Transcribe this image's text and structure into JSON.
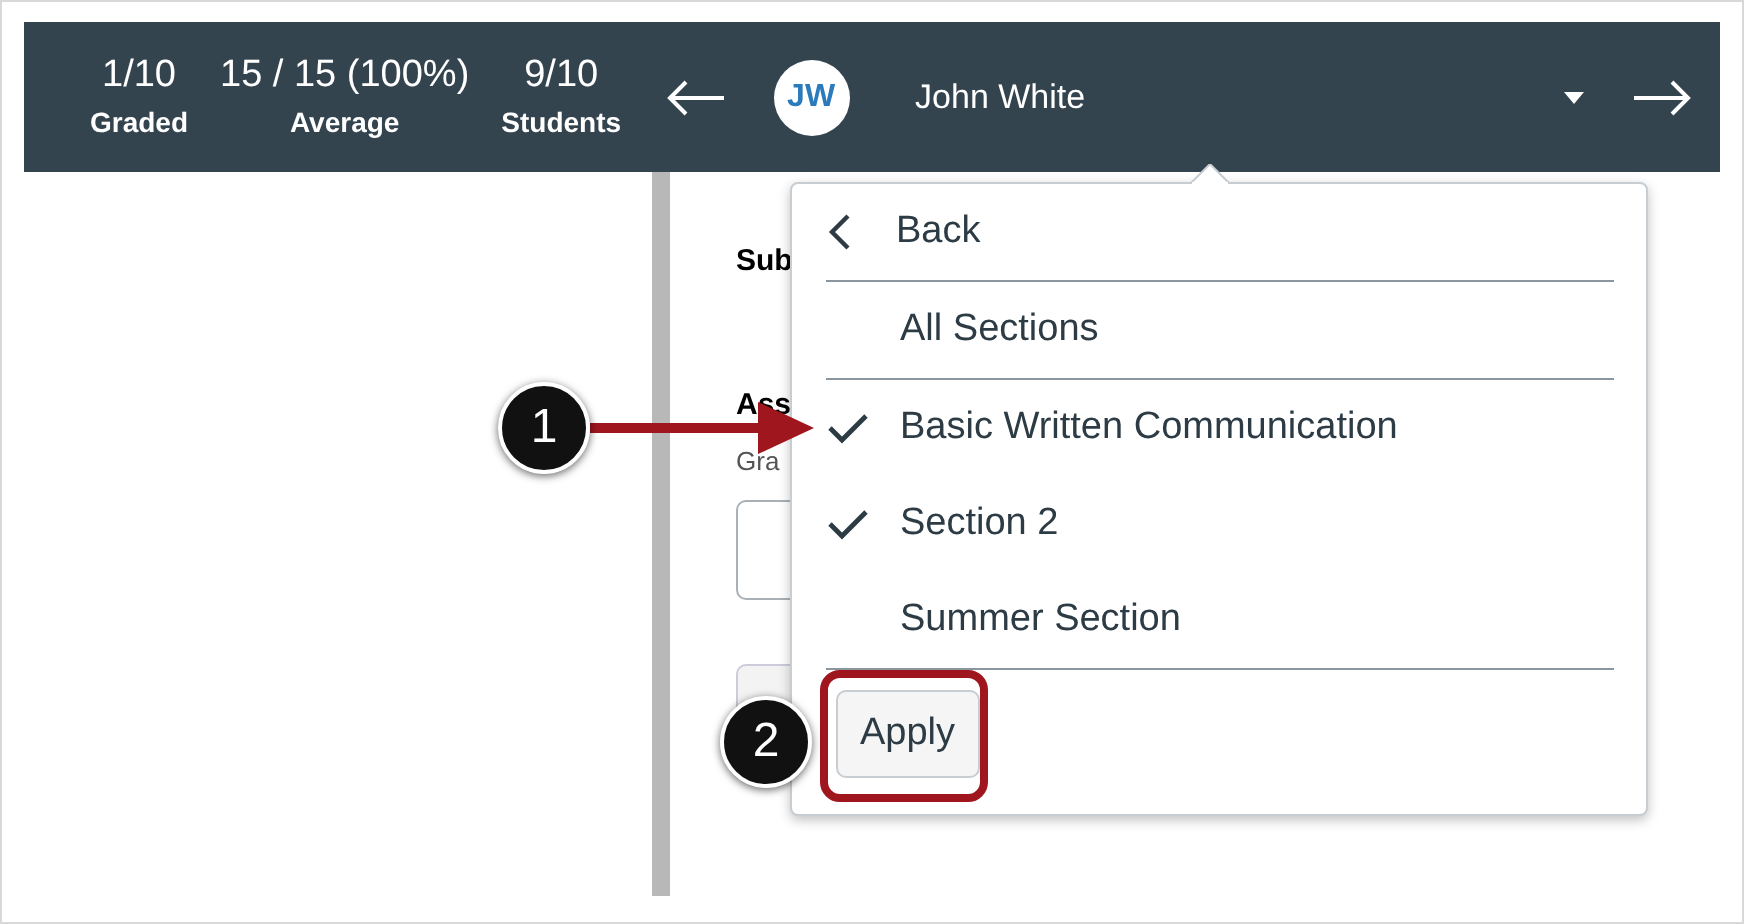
{
  "header": {
    "stats": [
      {
        "value": "1/10",
        "label": "Graded"
      },
      {
        "value": "15 / 15 (100%)",
        "label": "Average"
      },
      {
        "value": "9/10",
        "label": "Students"
      }
    ],
    "student": {
      "initials": "JW",
      "name": "John White"
    }
  },
  "content": {
    "heading_1": "Sub",
    "heading_2": "Ass",
    "hint": "Gra"
  },
  "menu": {
    "back": "Back",
    "items": [
      {
        "label": "All Sections",
        "checked": false
      },
      {
        "label": "Basic Written Communication",
        "checked": true
      },
      {
        "label": "Section 2",
        "checked": true
      },
      {
        "label": "Summer Section",
        "checked": false
      }
    ],
    "apply": "Apply"
  },
  "callouts": [
    "1",
    "2"
  ]
}
